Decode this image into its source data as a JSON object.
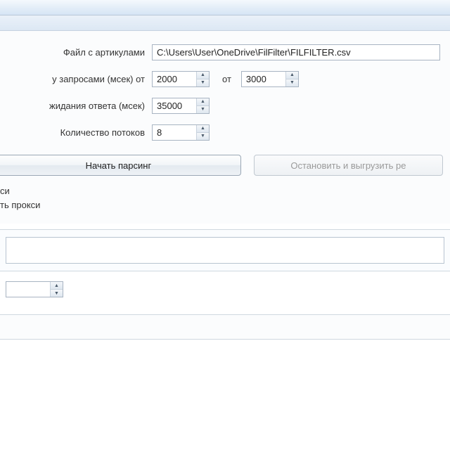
{
  "labels": {
    "file_with_articles": "Файл с артикулами",
    "delay_between_requests": "у запросами (мсек) от",
    "between_to": "от",
    "response_timeout": "жидания ответа (мсек)",
    "thread_count": "Количество потоков",
    "proxy_short": "си",
    "check_proxy": "ть прокси"
  },
  "values": {
    "file_path": "C:\\Users\\User\\OneDrive\\FilFilter\\FILFILTER.csv",
    "delay_from": "2000",
    "delay_to": "3000",
    "timeout": "35000",
    "threads": "8",
    "extra_numeric": ""
  },
  "buttons": {
    "start_parsing": "Начать парсинг",
    "stop_export": "Остановить и выгрузить ре"
  }
}
